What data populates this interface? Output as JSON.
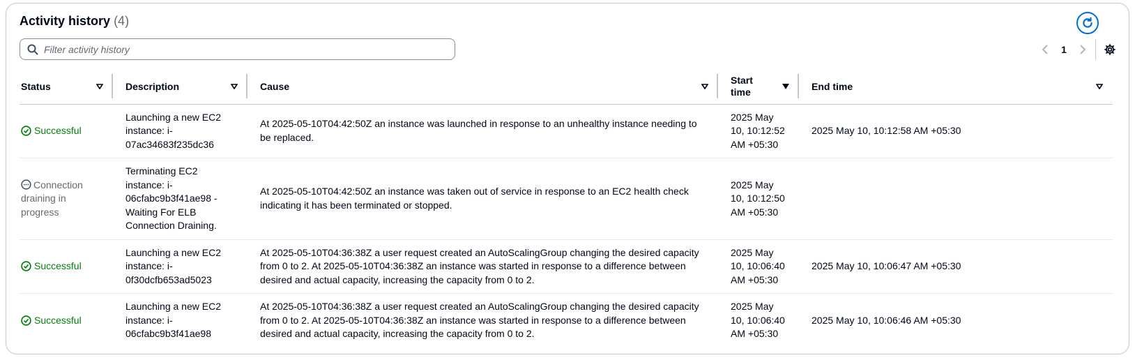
{
  "header": {
    "title": "Activity history",
    "count": "(4)"
  },
  "search": {
    "placeholder": "Filter activity history",
    "value": ""
  },
  "pagination": {
    "current_page": "1"
  },
  "columns": [
    {
      "label": "Status"
    },
    {
      "label": "Description"
    },
    {
      "label": "Cause"
    },
    {
      "label": "Start time"
    },
    {
      "label": "End time"
    }
  ],
  "rows": [
    {
      "status": "Successful",
      "description": "Launching a new EC2 instance: i-07ac34683f235dc36",
      "cause": "At 2025-05-10T04:42:50Z an instance was launched in response to an unhealthy instance needing to be replaced.",
      "start_time": "2025 May 10, 10:12:52 AM +05:30",
      "end_time": "2025 May 10, 10:12:58 AM +05:30"
    },
    {
      "status": "Connection draining in progress",
      "description": "Terminating EC2 instance: i-06cfabc9b3f41ae98 - Waiting For ELB Connection Draining.",
      "cause": "At 2025-05-10T04:42:50Z an instance was taken out of service in response to an EC2 health check indicating it has been terminated or stopped.",
      "start_time": "2025 May 10, 10:12:50 AM +05:30",
      "end_time": ""
    },
    {
      "status": "Successful",
      "description": "Launching a new EC2 instance: i-0f30dcfb653ad5023",
      "cause": "At 2025-05-10T04:36:38Z a user request created an AutoScalingGroup changing the desired capacity from 0 to 2. At 2025-05-10T04:36:38Z an instance was started in response to a difference between desired and actual capacity, increasing the capacity from 0 to 2.",
      "start_time": "2025 May 10, 10:06:40 AM +05:30",
      "end_time": "2025 May 10, 10:06:47 AM +05:30"
    },
    {
      "status": "Successful",
      "description": "Launching a new EC2 instance: i-06cfabc9b3f41ae98",
      "cause": "At 2025-05-10T04:36:38Z a user request created an AutoScalingGroup changing the desired capacity from 0 to 2. At 2025-05-10T04:36:38Z an instance was started in response to a difference between desired and actual capacity, increasing the capacity from 0 to 2.",
      "start_time": "2025 May 10, 10:06:40 AM +05:30",
      "end_time": "2025 May 10, 10:06:46 AM +05:30"
    }
  ],
  "colors": {
    "accent": "#006ce0",
    "success": "#037f0c",
    "muted": "#656871",
    "border": "#c6c6cd"
  },
  "icons": {
    "refresh": "refresh-icon",
    "search": "search-icon",
    "prev": "chevron-left-icon",
    "next": "chevron-right-icon",
    "settings": "gear-icon",
    "sort": "caret-down-icon",
    "success": "check-circle-icon",
    "in_progress": "ellipsis-circle-icon"
  }
}
